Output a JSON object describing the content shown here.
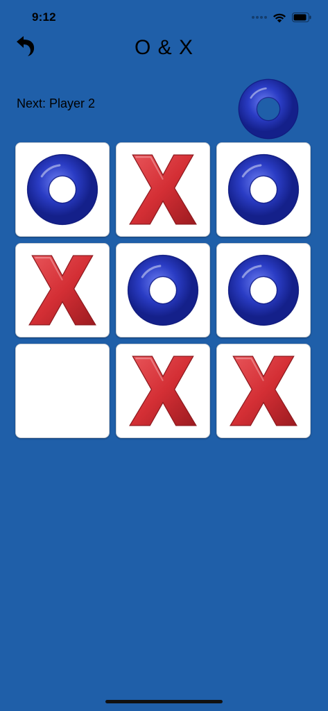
{
  "status_bar": {
    "time": "9:12"
  },
  "header": {
    "title": "O & X",
    "back_icon": "undo-arrow-icon"
  },
  "turn": {
    "label": "Next: Player 2",
    "next_piece": "O"
  },
  "board": {
    "cells": [
      "O",
      "X",
      "O",
      "X",
      "O",
      "O",
      "",
      "X",
      "X"
    ]
  },
  "colors": {
    "background": "#1f5fa9",
    "o_piece": "#2a3cc4",
    "x_piece": "#d42f35",
    "cell": "#ffffff"
  }
}
